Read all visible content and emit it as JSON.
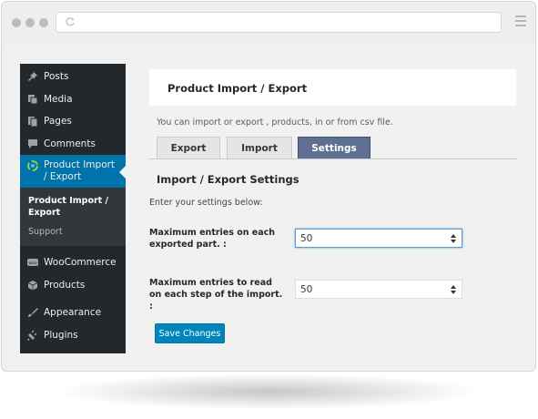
{
  "sidebar": {
    "items": [
      {
        "label": "Posts",
        "icon": "pushpin-icon"
      },
      {
        "label": "Media",
        "icon": "media-icon"
      },
      {
        "label": "Pages",
        "icon": "pages-icon"
      },
      {
        "label": "Comments",
        "icon": "comment-icon"
      },
      {
        "label": "Product Import / Export",
        "icon": "plugin-logo-icon"
      },
      {
        "label": "WooCommerce",
        "icon": "woocommerce-icon"
      },
      {
        "label": "Products",
        "icon": "box-icon"
      },
      {
        "label": "Appearance",
        "icon": "brush-icon"
      },
      {
        "label": "Plugins",
        "icon": "plug-icon"
      }
    ],
    "submenu": [
      "Product Import / Export",
      "Support"
    ]
  },
  "page": {
    "title": "Product Import / Export",
    "description": "You can import or export , products, in or from csv file.",
    "tabs": [
      "Export",
      "Import",
      "Settings"
    ],
    "active_tab": "Settings",
    "section_title": "Import / Export Settings",
    "hint": "Enter your settings below:"
  },
  "settings": {
    "export_label": "Maximum entries on each exported part. :",
    "export_value": "50",
    "import_label": "Maximum entries to read on each step of the import. :",
    "import_value": "50"
  },
  "actions": {
    "save_label": "Save Changes"
  },
  "colors": {
    "sidebar_bg": "#23282d",
    "active_menu": "#0073aa",
    "active_tab": "#5f6f8f",
    "button": "#0085ba"
  }
}
